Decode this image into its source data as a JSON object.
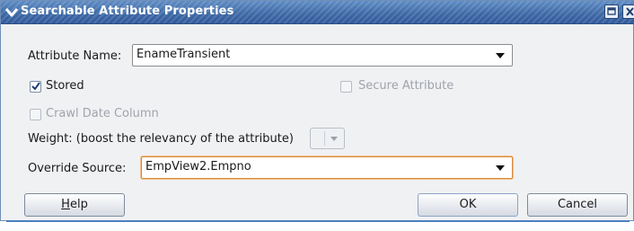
{
  "window": {
    "title": "Searchable Attribute Properties"
  },
  "form": {
    "attribute_name_label": "Attribute Name:",
    "attribute_name_value": "EnameTransient",
    "stored_label": "Stored",
    "stored_checked": true,
    "secure_attribute_label": "Secure Attribute",
    "secure_attribute_checked": false,
    "crawl_date_label": "Crawl Date Column",
    "crawl_date_checked": false,
    "weight_label": "Weight: (boost the relevancy of the attribute)",
    "weight_value": "",
    "override_source_label": "Override Source:",
    "override_source_value": "EmpView2.Empno"
  },
  "buttons": {
    "help_prefix": "",
    "help_mnemonic": "H",
    "help_rest": "elp",
    "ok_label": "OK",
    "cancel_label": "Cancel"
  },
  "colors": {
    "titlebar": "#3e6aa6",
    "focus_border": "#d88a3c",
    "dialog_bg": "#f0f1f3"
  }
}
